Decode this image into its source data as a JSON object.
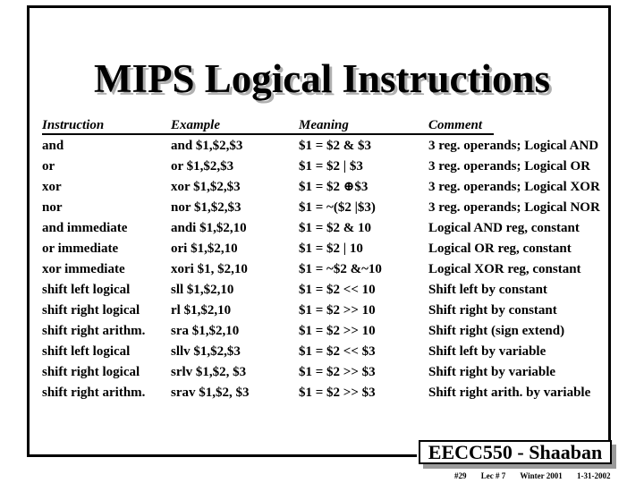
{
  "slide": {
    "title": "MIPS Logical Instructions",
    "table": {
      "headers": {
        "instruction": "Instruction",
        "example": "Example",
        "meaning": "Meaning",
        "comment": "Comment"
      },
      "rows": [
        {
          "instruction": "and",
          "example": "and $1,$2,$3",
          "meaning": "$1 = $2 & $3",
          "comment": "3 reg. operands; Logical AND"
        },
        {
          "instruction": "or",
          "example": "or $1,$2,$3",
          "meaning": "$1 = $2 | $3",
          "comment": "3 reg. operands; Logical OR"
        },
        {
          "instruction": "xor",
          "example": "xor $1,$2,$3",
          "meaning": "$1 = $2 ⊕$3",
          "comment": "3 reg. operands; Logical XOR"
        },
        {
          "instruction": "nor",
          "example": "nor $1,$2,$3",
          "meaning": "$1 = ~($2 |$3)",
          "comment": "3 reg. operands; Logical NOR"
        },
        {
          "instruction": "and immediate",
          "example": "andi $1,$2,10",
          "meaning": "$1 = $2 & 10",
          "comment": "Logical AND reg, constant"
        },
        {
          "instruction": "or immediate",
          "example": "ori $1,$2,10",
          "meaning": "$1 = $2 | 10",
          "comment": "Logical OR reg, constant"
        },
        {
          "instruction": "xor immediate",
          "example": "xori $1, $2,10",
          "meaning": "$1 = ~$2 &~10",
          "comment": "Logical XOR reg, constant"
        },
        {
          "instruction": "shift left logical",
          "example": "sll $1,$2,10",
          "meaning": "$1 = $2 << 10",
          "comment": "Shift left by constant"
        },
        {
          "instruction": "shift right logical",
          "example": "rl $1,$2,10",
          "meaning": "$1 = $2 >> 10",
          "comment": "Shift right by constant"
        },
        {
          "instruction": "shift right arithm.",
          "example": "sra $1,$2,10",
          "meaning": "$1 = $2 >> 10",
          "comment": "Shift right (sign extend)"
        },
        {
          "instruction": "shift left logical",
          "example": "sllv $1,$2,$3",
          "meaning": "$1 = $2 << $3",
          "comment": "Shift left by variable"
        },
        {
          "instruction": "shift right logical",
          "example": "srlv $1,$2, $3",
          "meaning": "$1 = $2 >> $3",
          "comment": "Shift right by variable"
        },
        {
          "instruction": "shift right arithm.",
          "example": "srav $1,$2, $3",
          "meaning": "$1 = $2 >> $3",
          "comment": "Shift right arith. by variable"
        }
      ]
    }
  },
  "footer": {
    "course": "EECC550 - Shaaban",
    "slide_number": "#29",
    "lecture": "Lec # 7",
    "term": "Winter 2001",
    "date": "1-31-2002"
  }
}
